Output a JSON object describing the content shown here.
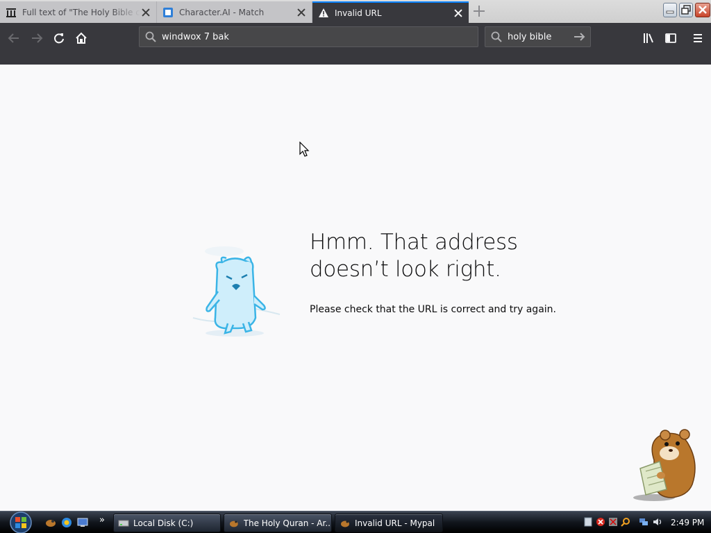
{
  "tabs": [
    {
      "title": "Full text of \"The Holy Bible co",
      "favicon": "archive-building-icon"
    },
    {
      "title": "Character.AI - Match",
      "favicon": "character-ai-icon"
    },
    {
      "title": "Invalid URL",
      "favicon": "warning-icon",
      "active": true
    }
  ],
  "nav": {
    "url_value": "windwox 7 bak",
    "search_value": "holy bible"
  },
  "error": {
    "title": "Hmm. That address doesn’t look right.",
    "description": "Please check that the URL is correct and try again."
  },
  "taskbar": {
    "items": [
      {
        "label": "Local Disk (C:)"
      },
      {
        "label": "The Holy Quran - Ar..."
      },
      {
        "label": "Invalid URL - Mypal"
      }
    ],
    "overflow": "»",
    "clock": "2:49 PM"
  },
  "colors": {
    "accent": "#0a84ff",
    "toolbar": "#38383d",
    "page_bg": "#f9f9fa"
  }
}
